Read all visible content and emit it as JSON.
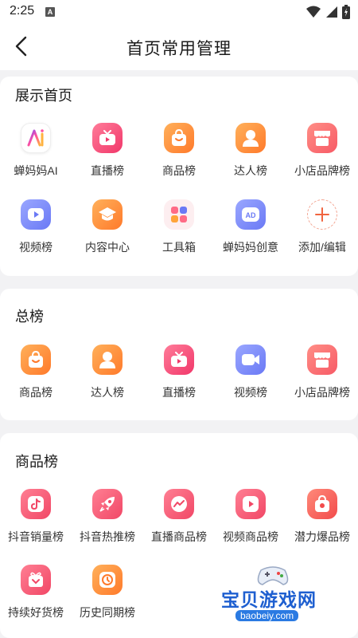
{
  "status_bar": {
    "time": "2:25",
    "notification_letter": "A"
  },
  "nav": {
    "title": "首页常用管理"
  },
  "sections": [
    {
      "title": "展示首页",
      "items": [
        {
          "label": "蝉妈妈AI",
          "icon": "ai-logo-icon"
        },
        {
          "label": "直播榜",
          "icon": "tv-icon"
        },
        {
          "label": "商品榜",
          "icon": "shopping-bag-icon"
        },
        {
          "label": "达人榜",
          "icon": "person-icon"
        },
        {
          "label": "小店品牌榜",
          "icon": "store-icon"
        },
        {
          "label": "视频榜",
          "icon": "video-play-icon"
        },
        {
          "label": "内容中心",
          "icon": "graduation-cap-icon"
        },
        {
          "label": "工具箱",
          "icon": "toolbox-grid-icon"
        },
        {
          "label": "蝉妈妈创意",
          "icon": "ad-icon"
        },
        {
          "label": "添加/编辑",
          "icon": "plus-icon"
        }
      ]
    },
    {
      "title": "总榜",
      "items": [
        {
          "label": "商品榜",
          "icon": "shopping-bag-icon"
        },
        {
          "label": "达人榜",
          "icon": "person-icon"
        },
        {
          "label": "直播榜",
          "icon": "tv-icon"
        },
        {
          "label": "视频榜",
          "icon": "video-camera-icon"
        },
        {
          "label": "小店品牌榜",
          "icon": "store-icon"
        }
      ]
    },
    {
      "title": "商品榜",
      "items": [
        {
          "label": "抖音销量榜",
          "icon": "douyin-icon"
        },
        {
          "label": "抖音热推榜",
          "icon": "rocket-icon"
        },
        {
          "label": "直播商品榜",
          "icon": "live-chart-icon"
        },
        {
          "label": "视频商品榜",
          "icon": "video-play-icon"
        },
        {
          "label": "潜力爆品榜",
          "icon": "potential-bag-icon"
        },
        {
          "label": "持续好货榜",
          "icon": "gift-icon"
        },
        {
          "label": "历史同期榜",
          "icon": "history-clock-icon"
        }
      ]
    }
  ],
  "watermark": {
    "title": "宝贝游戏网",
    "url": "baobeiy.com"
  }
}
